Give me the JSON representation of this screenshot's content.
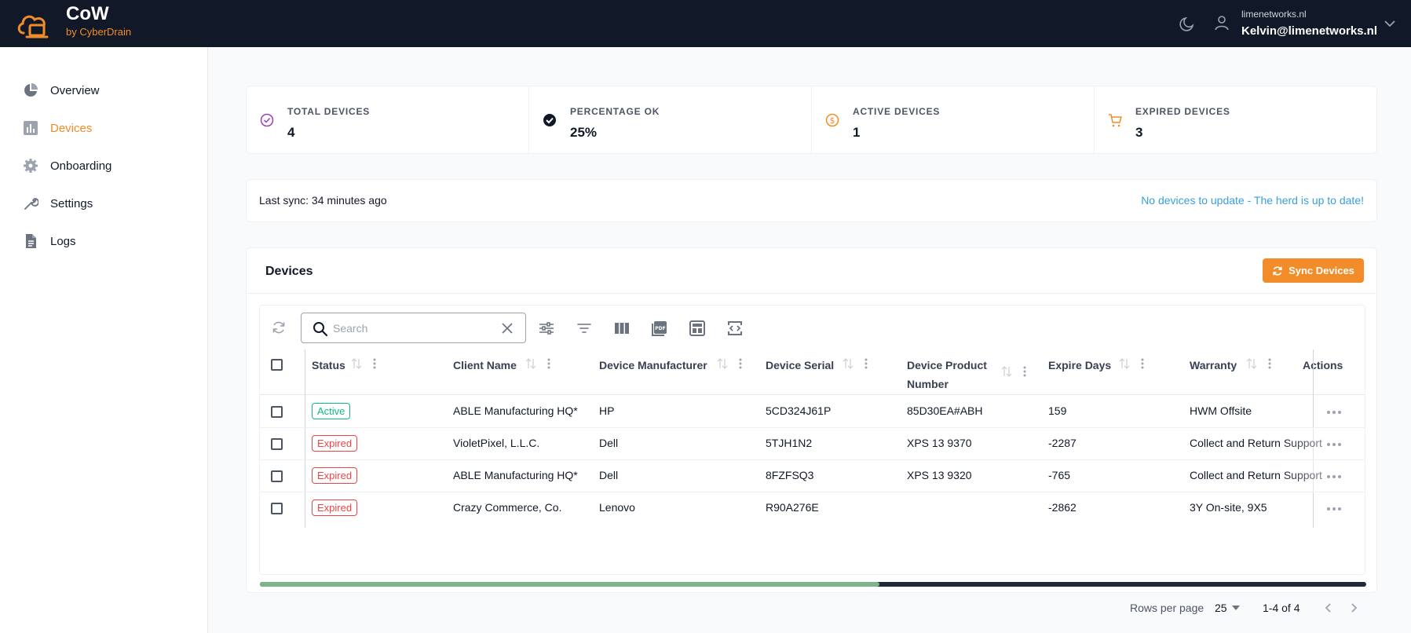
{
  "header": {
    "brand_title": "CoW",
    "brand_subtitle": "by CyberDrain",
    "user_org": "limenetworks.nl",
    "user_email": "Kelvin@limenetworks.nl"
  },
  "sidebar": {
    "items": [
      {
        "label": "Overview",
        "icon": "pie-chart-icon",
        "active": false
      },
      {
        "label": "Devices",
        "icon": "bar-chart-icon",
        "active": true
      },
      {
        "label": "Onboarding",
        "icon": "gear-icon",
        "active": false
      },
      {
        "label": "Settings",
        "icon": "wrench-icon",
        "active": false
      },
      {
        "label": "Logs",
        "icon": "document-icon",
        "active": false
      }
    ]
  },
  "stats": [
    {
      "label": "TOTAL DEVICES",
      "value": "4",
      "icon": "check-circle-icon",
      "color": "#9b3fb5"
    },
    {
      "label": "PERCENTAGE OK",
      "value": "25%",
      "icon": "check-badge-icon",
      "color": "#111827"
    },
    {
      "label": "ACTIVE DEVICES",
      "value": "1",
      "icon": "dollar-icon",
      "color": "#f28c28"
    },
    {
      "label": "EXPIRED DEVICES",
      "value": "3",
      "icon": "cart-icon",
      "color": "#f28c28"
    }
  ],
  "sync": {
    "last_sync": "Last sync: 34 minutes ago",
    "status": "No devices to update - The herd is up to date!"
  },
  "devices": {
    "title": "Devices",
    "sync_button": "Sync Devices",
    "search_placeholder": "Search",
    "columns": [
      "Status",
      "Client Name",
      "Device Manufacturer",
      "Device Serial",
      "Device Product Number",
      "Expire Days",
      "Warranty",
      "Actions"
    ],
    "rows": [
      {
        "status": "Active",
        "client": "ABLE Manufacturing HQ*",
        "manufacturer": "HP",
        "serial": "5CD324J61P",
        "product": "85D30EA#ABH",
        "expire": "159",
        "warranty": "HWM Offsite"
      },
      {
        "status": "Expired",
        "client": "VioletPixel, L.L.C.",
        "manufacturer": "Dell",
        "serial": "5TJH1N2",
        "product": "XPS 13 9370",
        "expire": "-2287",
        "warranty": "Collect and Return Support"
      },
      {
        "status": "Expired",
        "client": "ABLE Manufacturing HQ*",
        "manufacturer": "Dell",
        "serial": "8FZFSQ3",
        "product": "XPS 13 9320",
        "expire": "-765",
        "warranty": "Collect and Return Support"
      },
      {
        "status": "Expired",
        "client": "Crazy Commerce, Co.",
        "manufacturer": "Lenovo",
        "serial": "R90A276E",
        "product": "",
        "expire": "-2862",
        "warranty": "3Y On-site, 9X5"
      }
    ],
    "horizontal_scroll_fraction": 0.56,
    "pagination": {
      "rows_per_page_label": "Rows per page",
      "rows_per_page": "25",
      "range": "1-4 of 4"
    }
  },
  "colors": {
    "accent": "#f28c28",
    "header_bg": "#111827",
    "active_badge": "#10b981",
    "expired_badge": "#ef4444",
    "link": "#3b9ed9"
  }
}
